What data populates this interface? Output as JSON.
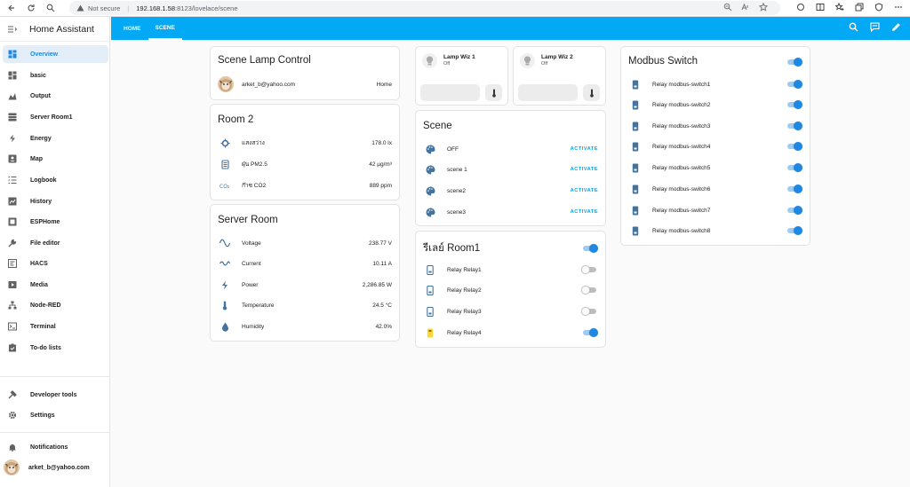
{
  "browser": {
    "security": "Not secure",
    "host": "192.168.1.58",
    "path": ":8123/lovelace/scene"
  },
  "sidebar": {
    "title": "Home Assistant",
    "items": [
      {
        "label": "Overview",
        "icon": "overview-icon",
        "active": true
      },
      {
        "label": "basic",
        "icon": "dashboard-icon"
      },
      {
        "label": "Output",
        "icon": "chart-icon"
      },
      {
        "label": "Server Room1",
        "icon": "server-icon"
      },
      {
        "label": "Energy",
        "icon": "energy-icon"
      },
      {
        "label": "Map",
        "icon": "map-icon"
      },
      {
        "label": "Logbook",
        "icon": "logbook-icon"
      },
      {
        "label": "History",
        "icon": "history-icon"
      },
      {
        "label": "ESPHome",
        "icon": "esphome-icon"
      },
      {
        "label": "File editor",
        "icon": "wrench-icon"
      },
      {
        "label": "HACS",
        "icon": "hacs-icon"
      },
      {
        "label": "Media",
        "icon": "media-icon"
      },
      {
        "label": "Node-RED",
        "icon": "sitemap-icon"
      },
      {
        "label": "Terminal",
        "icon": "terminal-icon"
      },
      {
        "label": "To-do lists",
        "icon": "todo-icon"
      }
    ],
    "dev_tools": "Developer tools",
    "settings": "Settings",
    "notifications": "Notifications",
    "user": "arket_b@yahoo.com"
  },
  "appbar": {
    "tabs": [
      {
        "label": "HOME",
        "active": false
      },
      {
        "label": "SCENE",
        "active": true
      }
    ]
  },
  "scene_lamp": {
    "title": "Scene Lamp Control",
    "user": "arket_b@yahoo.com",
    "state": "Home"
  },
  "room2": {
    "title": "Room 2",
    "rows": [
      {
        "name": "แสงสว่าง",
        "value": "178.0 lx",
        "icon": "brightness-icon"
      },
      {
        "name": "ฝุ่น PM2.5",
        "value": "42 µg/m³",
        "icon": "pm25-icon"
      },
      {
        "name": "ก๊าซ CO2",
        "value": "889 ppm",
        "icon": "co2-icon"
      }
    ]
  },
  "server_room": {
    "title": "Server Room",
    "rows": [
      {
        "name": "Voltage",
        "value": "238.77 V",
        "icon": "sine-wave-icon"
      },
      {
        "name": "Current",
        "value": "10.11 A",
        "icon": "current-ac-icon"
      },
      {
        "name": "Power",
        "value": "2,286.85 W",
        "icon": "flash-icon"
      },
      {
        "name": "Temperature",
        "value": "24.5 °C",
        "icon": "thermometer-icon"
      },
      {
        "name": "Humidity",
        "value": "42.0%",
        "icon": "water-percent-icon"
      }
    ]
  },
  "lamps": [
    {
      "name": "Lamp Wiz 1",
      "state": "Off"
    },
    {
      "name": "Lamp Wiz 2",
      "state": "Off"
    }
  ],
  "scene": {
    "title": "Scene",
    "rows": [
      {
        "name": "OFF",
        "action": "ACTIVATE"
      },
      {
        "name": "scene 1",
        "action": "ACTIVATE"
      },
      {
        "name": "scene2",
        "action": "ACTIVATE"
      },
      {
        "name": "scene3",
        "action": "ACTIVATE"
      }
    ]
  },
  "relay_room1": {
    "title": "รีเลย์ Room1",
    "master_on": true,
    "rows": [
      {
        "name": "Relay Relay1",
        "on": false
      },
      {
        "name": "Relay Relay2",
        "on": false
      },
      {
        "name": "Relay Relay3",
        "on": false
      },
      {
        "name": "Relay Relay4",
        "on": true
      }
    ]
  },
  "modbus": {
    "title": "Modbus Switch",
    "master_on": true,
    "rows": [
      {
        "name": "Relay modbus-switch1",
        "on": true
      },
      {
        "name": "Relay modbus-switch2",
        "on": true
      },
      {
        "name": "Relay modbus-switch3",
        "on": true
      },
      {
        "name": "Relay modbus-switch4",
        "on": true
      },
      {
        "name": "Relay modbus-switch5",
        "on": true
      },
      {
        "name": "Relay modbus-switch6",
        "on": true
      },
      {
        "name": "Relay modbus-switch7",
        "on": true
      },
      {
        "name": "Relay modbus-switch8",
        "on": true
      }
    ]
  },
  "colors": {
    "accent": "#03a9f4",
    "toggle_on": "#1e88e5",
    "icon": "#44739e",
    "relay_on": "#fdd835"
  }
}
